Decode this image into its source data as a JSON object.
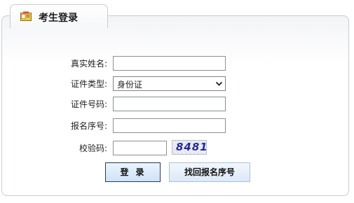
{
  "tab": {
    "title": "考生登录",
    "icon": "id-card-icon"
  },
  "form": {
    "real_name": {
      "label": "真实姓名:",
      "value": ""
    },
    "id_type": {
      "label": "证件类型:",
      "selected": "身份证"
    },
    "id_number": {
      "label": "证件号码:",
      "value": ""
    },
    "registration_number": {
      "label": "报名序号:",
      "value": ""
    },
    "captcha": {
      "label": "校验码:",
      "value": "",
      "image_text": "8481"
    }
  },
  "buttons": {
    "login": "登录",
    "recover": "找回报名序号"
  },
  "colors": {
    "panel_border": "#c8ccd2",
    "captcha_text": "#2a2a8c",
    "button_border": "#2a3b55"
  }
}
